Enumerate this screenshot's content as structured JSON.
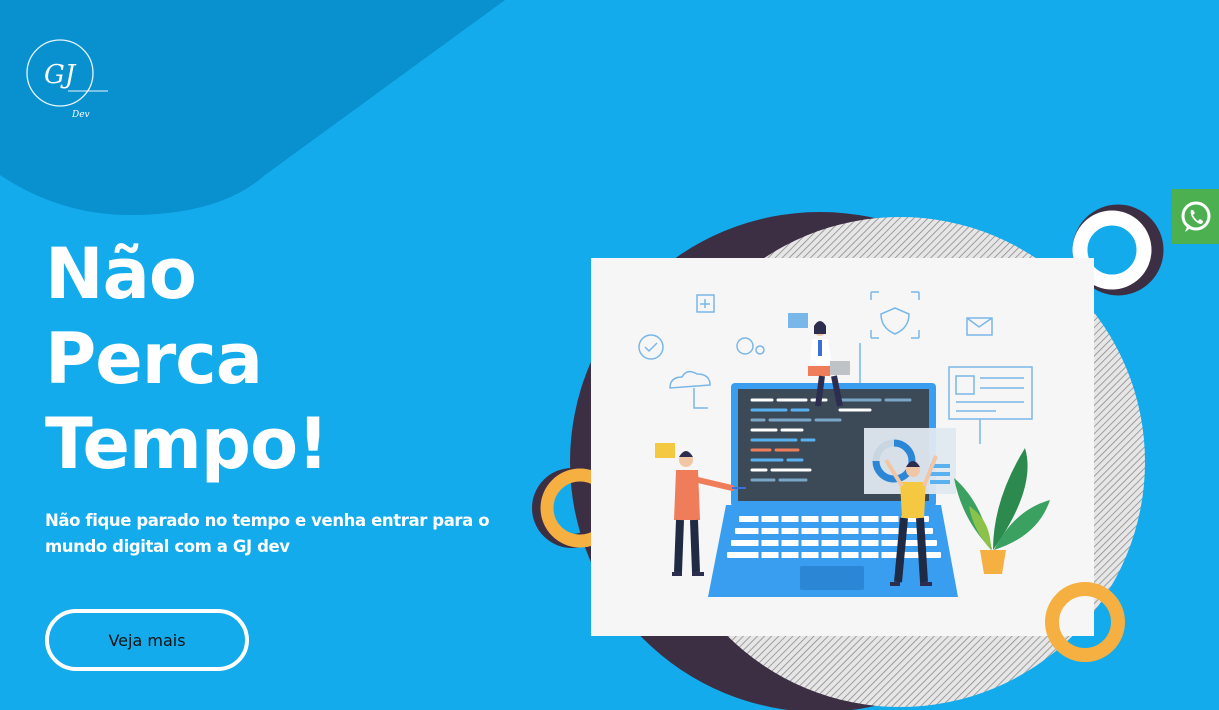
{
  "brand": {
    "logo_text": "GJ",
    "logo_sub": "Dev"
  },
  "hero": {
    "title_lines": [
      "Não",
      "Perca",
      "Tempo!"
    ],
    "subtitle_line1": "Não fique parado no tempo e venha entrar para o",
    "subtitle_line2": "mundo digital com a GJ dev",
    "cta_label": "Veja mais"
  },
  "floating": {
    "icon": "whatsapp-icon"
  },
  "colors": {
    "background": "#13abec",
    "top_shape": "#0890cf",
    "dark_circle": "#3d2f43",
    "ring_white": "#ffffff",
    "ring_orange": "#f5b041",
    "whatsapp_bg": "#4caf50"
  }
}
